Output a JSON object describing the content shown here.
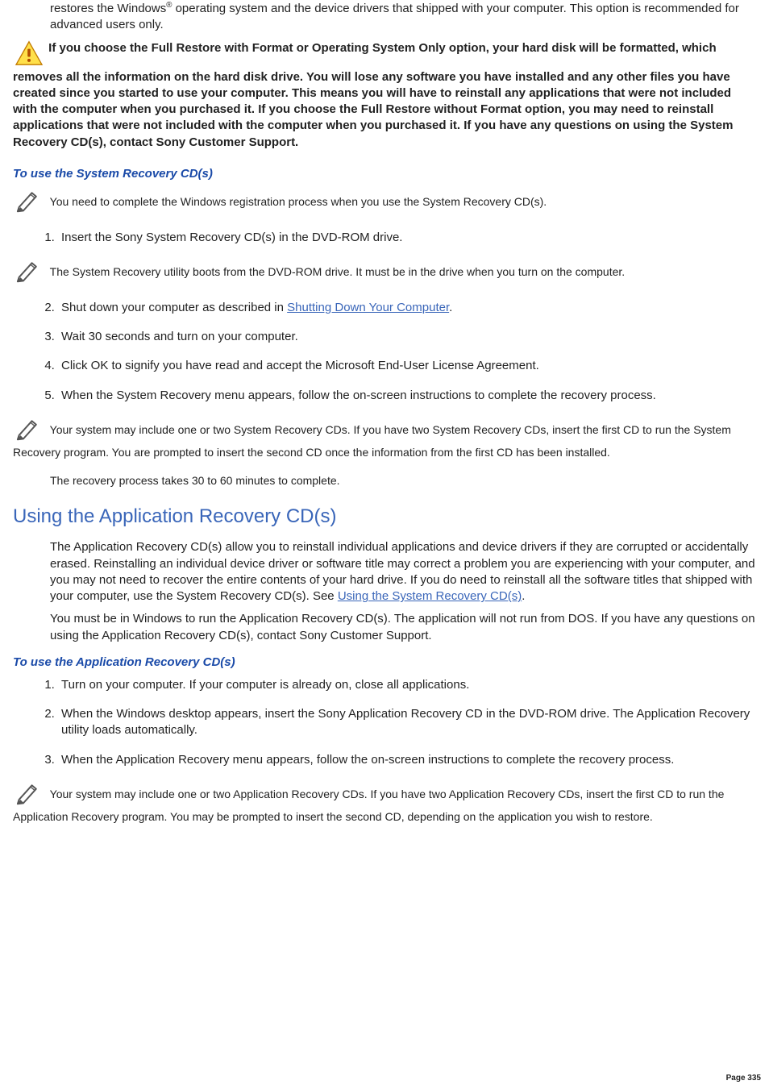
{
  "intro_para": "restores the Windows® operating system and the device drivers that shipped with your computer. This option is recommended for advanced users only.",
  "warning_text": "If you choose the Full Restore with Format or Operating System Only option, your hard disk will be formatted, which removes all the information on the hard disk drive. You will lose any software you have installed and any other files you have created since you started to use your computer. This means you will have to reinstall any applications that were not included with the computer when you purchased it. If you choose the Full Restore without Format option, you may need to reinstall applications that were not included with the computer when you purchased it. If you have any questions on using the System Recovery CD(s), contact Sony Customer Support.",
  "spacer": " ",
  "section1": {
    "heading": "To use the System Recovery CD(s)",
    "note1": "You need to complete the Windows registration process when you use the System Recovery CD(s).",
    "step1": "Insert the Sony System Recovery CD(s) in the DVD-ROM drive.",
    "note2": "The System Recovery utility boots from the DVD-ROM drive. It must be in the drive when you turn on the computer.",
    "step2_pre": "Shut down your computer as described in ",
    "step2_link": "Shutting Down Your Computer",
    "step2_post": ".",
    "step3": "Wait 30 seconds and turn on your computer.",
    "step4": "Click OK to signify you have read and accept the Microsoft End-User License Agreement.",
    "step5": "When the System Recovery menu appears, follow the on-screen instructions to complete the recovery process.",
    "note3": "Your system may include one or two System Recovery CDs. If you have two System Recovery CDs, insert the first CD to run the System Recovery program. You are prompted to insert the second CD once the information from the first CD has been installed.",
    "note4": "The recovery process takes 30 to 60 minutes to complete."
  },
  "section2": {
    "heading": "Using the Application Recovery CD(s)",
    "para1_pre": "The Application Recovery CD(s) allow you to reinstall individual applications and device drivers if they are corrupted or accidentally erased. Reinstalling an individual device driver or software title may correct a problem you are experiencing with your computer, and you may not need to recover the entire contents of your hard drive. If you do need to reinstall all the software titles that shipped with your computer, use the System Recovery CD(s). See ",
    "para1_link": "Using the System Recovery CD(s)",
    "para1_post": ".",
    "para2": "You must be in Windows to run the Application Recovery CD(s). The application will not run from DOS. If you have any questions on using the Application Recovery CD(s), contact Sony Customer Support.",
    "subhead": "To use the Application Recovery CD(s)",
    "step1": "Turn on your computer. If your computer is already on, close all applications.",
    "step2": "When the Windows desktop appears, insert the Sony Application Recovery CD in the DVD-ROM drive. The Application Recovery utility loads automatically.",
    "step3": "When the Application Recovery menu appears, follow the on-screen instructions to complete the recovery process.",
    "note1": "Your system may include one or two Application Recovery CDs. If you have two Application Recovery CDs, insert the first CD to run the Application Recovery program. You may be prompted to insert the second CD, depending on the application you wish to restore."
  },
  "page_number": "Page 335"
}
